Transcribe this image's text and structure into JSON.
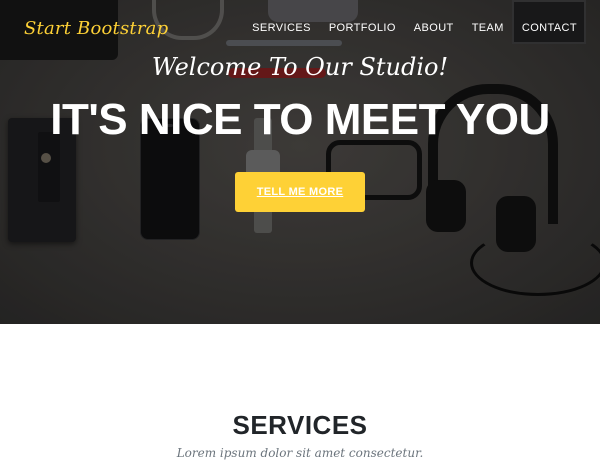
{
  "navbar": {
    "brand": "Start Bootstrap",
    "links": [
      "SERVICES",
      "PORTFOLIO",
      "ABOUT",
      "TEAM",
      "CONTACT"
    ]
  },
  "hero": {
    "lead_in": "Welcome To Our Studio!",
    "heading": "IT'S NICE TO MEET YOU",
    "button_label": "TELL ME MORE"
  },
  "services": {
    "heading": "SERVICES",
    "subheading": "Lorem ipsum dolor sit amet consectetur."
  },
  "colors": {
    "accent": "#fed136",
    "hero_text": "#ffffff",
    "heading_dark": "#212529",
    "muted": "#6c757d"
  }
}
